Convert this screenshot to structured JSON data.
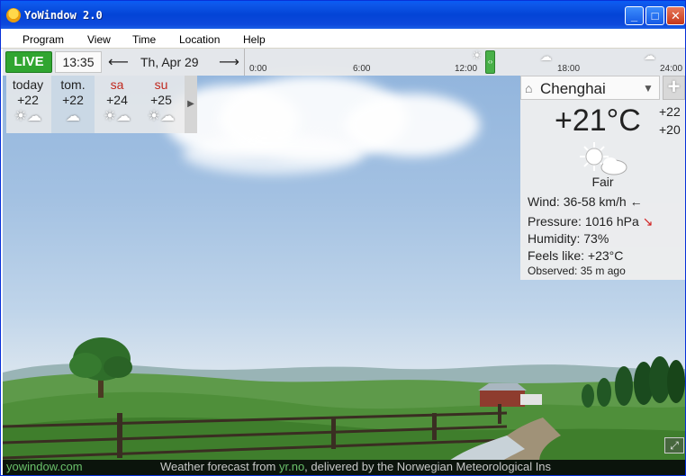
{
  "window": {
    "title": "YoWindow 2.0",
    "controls": {
      "minimize": "_",
      "maximize": "□",
      "close": "✕"
    }
  },
  "menu": [
    "Program",
    "View",
    "Time",
    "Location",
    "Help"
  ],
  "toolbar": {
    "live_label": "LIVE",
    "time": "13:35",
    "prev_icon": "arrow-left-icon",
    "next_icon": "arrow-right-icon",
    "date": "Th, Apr 29",
    "timeline_ticks": [
      "0:00",
      "6:00",
      "12:00",
      "18:00",
      "24:00"
    ],
    "timeline_icons": [
      "sun-cloud-icon",
      "cloud-icon",
      "rain-cloud-icon"
    ]
  },
  "forecast": [
    {
      "day": "today",
      "temp": "+22",
      "weekend": false,
      "selected": false,
      "icon": "partly-sunny-icon"
    },
    {
      "day": "tom.",
      "temp": "+22",
      "weekend": false,
      "selected": true,
      "icon": "cloud-icon"
    },
    {
      "day": "sa",
      "temp": "+24",
      "weekend": true,
      "selected": false,
      "icon": "partly-sunny-icon"
    },
    {
      "day": "su",
      "temp": "+25",
      "weekend": true,
      "selected": false,
      "icon": "partly-sunny-icon"
    }
  ],
  "current": {
    "location": "Chenghai",
    "temperature": "+21°C",
    "high": "+22",
    "low": "+20",
    "condition": "Fair",
    "wind_label": "Wind:",
    "wind_value": "36-58 km/h",
    "wind_arrow": "←",
    "pressure_label": "Pressure:",
    "pressure_value": "1016 hPa",
    "pressure_arrow": "↘",
    "humidity_label": "Humidity:",
    "humidity_value": "73%",
    "feels_label": "Feels like:",
    "feels_value": "+23°C",
    "observed_label": "Observed:",
    "observed_value": "35 m ago"
  },
  "status": {
    "left_link": "yowindow.com",
    "credit_prefix": "Weather forecast from ",
    "credit_link": "yr.no",
    "credit_suffix": ", delivered by the Norwegian Meteorological Ins"
  },
  "colors": {
    "live_green": "#30a530",
    "weekend_red": "#c0281e",
    "status_link": "#6ac06a"
  }
}
